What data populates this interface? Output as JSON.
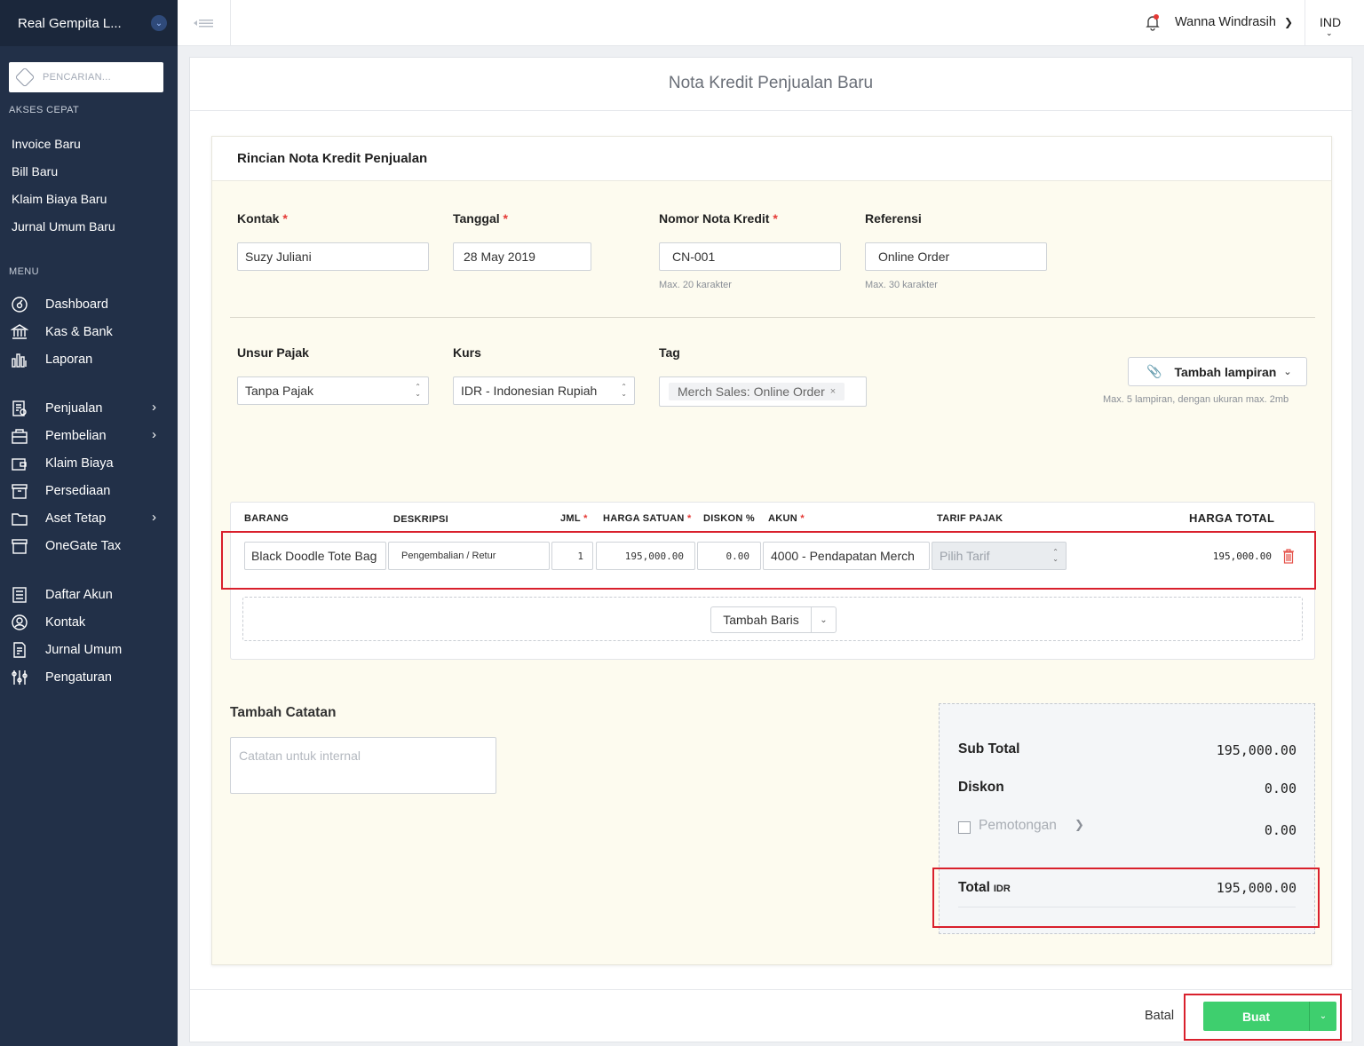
{
  "sidebar": {
    "company": "Real Gempita L...",
    "search_placeholder": "PENCARIAN...",
    "quick_access_label": "AKSES CEPAT",
    "quick_links": [
      "Invoice Baru",
      "Bill Baru",
      "Klaim Biaya Baru",
      "Jurnal Umum Baru"
    ],
    "menu_label": "MENU",
    "menu": [
      {
        "label": "Dashboard",
        "icon": "dashboard-icon"
      },
      {
        "label": "Kas & Bank",
        "icon": "bank-icon"
      },
      {
        "label": "Laporan",
        "icon": "chart-icon"
      },
      {
        "label": "Penjualan",
        "icon": "sales-icon"
      },
      {
        "label": "Pembelian",
        "icon": "purchase-icon"
      },
      {
        "label": "Klaim Biaya",
        "icon": "wallet-icon"
      },
      {
        "label": "Persediaan",
        "icon": "box-icon"
      },
      {
        "label": "Aset Tetap",
        "icon": "folder-icon"
      },
      {
        "label": "OneGate Tax",
        "icon": "tax-icon"
      },
      {
        "label": "Daftar Akun",
        "icon": "list-icon"
      },
      {
        "label": "Kontak",
        "icon": "contact-icon"
      },
      {
        "label": "Jurnal Umum",
        "icon": "journal-icon"
      },
      {
        "label": "Pengaturan",
        "icon": "settings-icon"
      }
    ]
  },
  "topbar": {
    "user": "Wanna Windrasih",
    "language": "IND"
  },
  "page": {
    "title": "Nota Kredit Penjualan Baru",
    "card_title": "Rincian Nota Kredit Penjualan"
  },
  "form": {
    "contact": {
      "label": "Kontak",
      "value": "Suzy Juliani"
    },
    "date": {
      "label": "Tanggal",
      "value": "28 May 2019"
    },
    "number": {
      "label": "Nomor Nota Kredit",
      "value": "CN-001",
      "hint": "Max. 20 karakter"
    },
    "reference": {
      "label": "Referensi",
      "value": "Online Order",
      "hint": "Max. 30 karakter"
    },
    "tax": {
      "label": "Unsur Pajak",
      "value": "Tanpa Pajak"
    },
    "currency": {
      "label": "Kurs",
      "value": "IDR - Indonesian Rupiah"
    },
    "tag": {
      "label": "Tag",
      "chip": "Merch Sales: Online Order"
    },
    "attachment": {
      "label": "Tambah lampiran",
      "hint": "Max. 5 lampiran, dengan ukuran max. 2mb"
    }
  },
  "items": {
    "headers": {
      "item": "BARANG",
      "description": "DESKRIPSI",
      "qty": "JML",
      "unit_price": "HARGA SATUAN",
      "discount": "DISKON %",
      "account": "AKUN",
      "tax_rate": "TARIF PAJAK",
      "total": "HARGA TOTAL"
    },
    "row": {
      "item": "Black Doodle Tote Bag",
      "description": "Pengembalian / Retur",
      "qty": "1",
      "unit_price": "195,000.00",
      "discount": "0.00",
      "account": "4000 - Pendapatan Merch",
      "tax_rate_placeholder": "Pilih Tarif",
      "total": "195,000.00"
    },
    "add_row": "Tambah Baris"
  },
  "notes": {
    "label": "Tambah Catatan",
    "placeholder": "Catatan untuk internal"
  },
  "summary": {
    "subtotal_label": "Sub Total",
    "subtotal": "195,000.00",
    "discount_label": "Diskon",
    "discount": "0.00",
    "deduction_label": "Pemotongan",
    "deduction": "0.00",
    "total_label": "Total",
    "total_currency": "IDR",
    "total": "195,000.00"
  },
  "footer": {
    "cancel": "Batal",
    "create": "Buat"
  },
  "colors": {
    "sidebar": "#223048",
    "primary_green": "#3ecf6e",
    "highlight_red": "#d9202c",
    "form_bg": "#fdfbef"
  }
}
